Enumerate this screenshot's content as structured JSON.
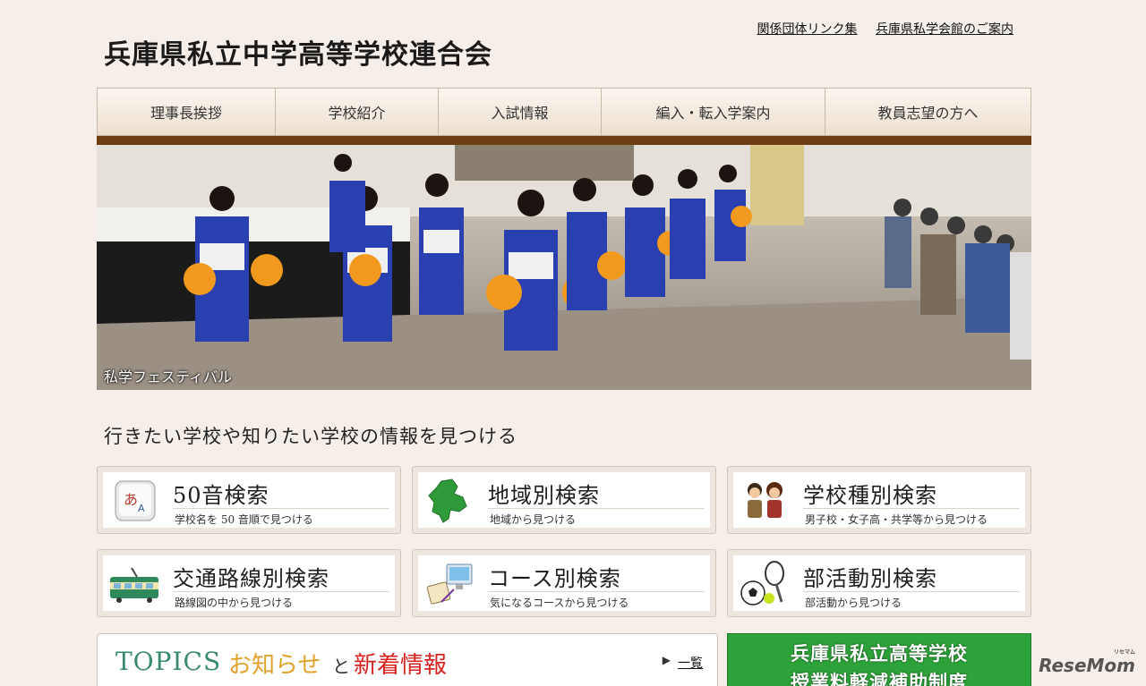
{
  "header": {
    "site_title": "兵庫県私立中学高等学校連合会",
    "links": [
      "関係団体リンク集",
      "兵庫県私学会館のご案内"
    ]
  },
  "nav": {
    "items": [
      "理事長挨拶",
      "学校紹介",
      "入試情報",
      "編入・転入学案内",
      "教員志望の方へ"
    ]
  },
  "hero": {
    "caption": "私学フェスティバル"
  },
  "find": {
    "heading": "行きたい学校や知りたい学校の情報を見つける",
    "buttons": [
      {
        "title": "50音検索",
        "sub": "学校名を 50 音順で見つける",
        "icon": "kana-key-icon"
      },
      {
        "title": "地域別検索",
        "sub": "地域から見つける",
        "icon": "hyogo-map-icon"
      },
      {
        "title": "学校種別検索",
        "sub": "男子校・女子高・共学等から見つける",
        "icon": "students-icon"
      },
      {
        "title": "交通路線別検索",
        "sub": "路線図の中から見つける",
        "icon": "train-icon"
      },
      {
        "title": "コース別検索",
        "sub": "気になるコースから見つける",
        "icon": "computer-icon"
      },
      {
        "title": "部活動別検索",
        "sub": "部活動から見つける",
        "icon": "sports-ball-icon"
      }
    ]
  },
  "topics": {
    "title_en": "TOPICS",
    "title_ja1": "お知らせ",
    "connector": "と",
    "title_ja2": "新着情報",
    "list_link": "一覧"
  },
  "banner": {
    "line1": "兵庫県私立高等学校",
    "line2": "授業料軽減補助制度"
  },
  "watermark": {
    "text": "ReseMom",
    "small": "リセマム"
  },
  "colors": {
    "background": "#f6efe9",
    "nav_bar": "#6b3e12",
    "topics_en": "#3a8a6c",
    "topics_ja1": "#e0a22a",
    "topics_ja2": "#d8231f",
    "banner": "#2ea23a"
  }
}
